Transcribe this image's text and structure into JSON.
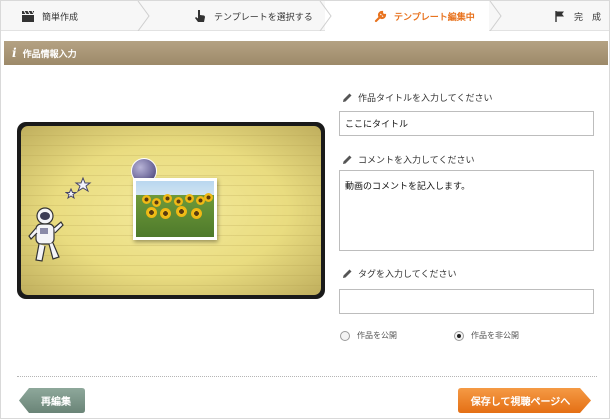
{
  "steps": [
    {
      "label": "簡単作成",
      "icon": "clapperboard-icon"
    },
    {
      "label": "テンプレートを選択する",
      "icon": "pointing-hand-icon"
    },
    {
      "label": "テンプレート編集中",
      "icon": "wrench-icon",
      "active": true
    },
    {
      "label": "完　成",
      "icon": "flag-icon"
    }
  ],
  "section": {
    "icon": "info-icon",
    "title": "作品情報入力"
  },
  "form": {
    "title_label": "作品タイトルを入力してください",
    "title_value": "ここにタイトル",
    "comment_label": "コメントを入力してください",
    "comment_value": "動画のコメントを記入します。",
    "tag_label": "タグを入力してください",
    "tag_value": "",
    "visibility": {
      "public_label": "作品を公開",
      "private_label": "作品を非公開",
      "selected": "private"
    }
  },
  "buttons": {
    "back_label": "再編集",
    "save_label": "保存して視聴ページへ"
  },
  "colors": {
    "accent_orange": "#f07d22",
    "back_button": "#7a9487",
    "section_header": "#a8967a"
  }
}
